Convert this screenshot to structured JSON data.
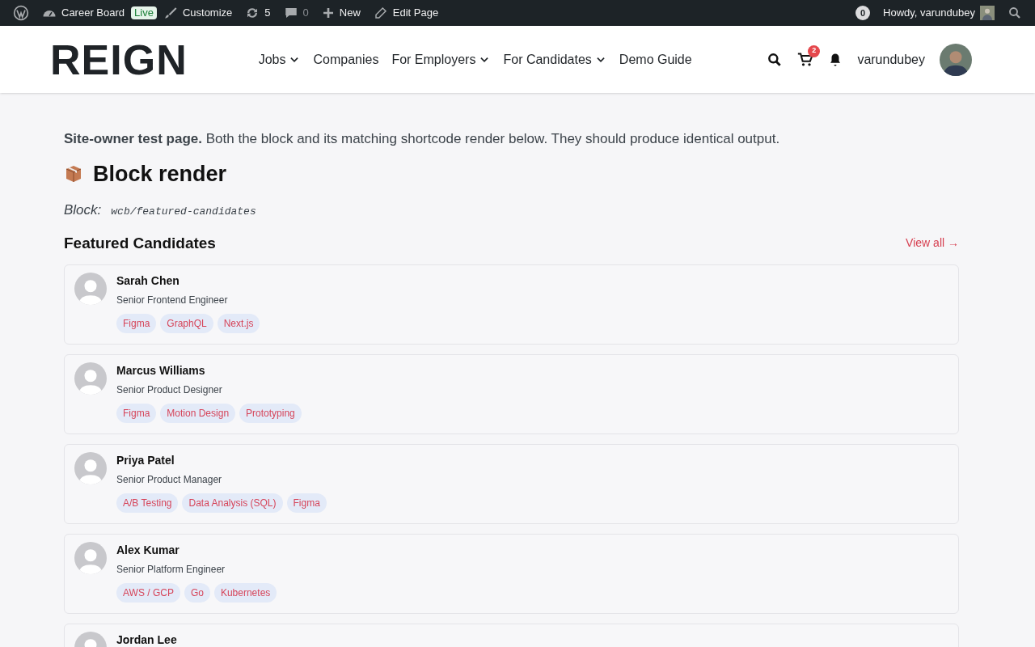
{
  "admin_bar": {
    "site": "Career Board",
    "live_badge": "Live",
    "customize": "Customize",
    "updates": "5",
    "comments": "0",
    "new": "New",
    "edit_page": "Edit Page",
    "notifications": "0",
    "howdy": "Howdy, varundubey"
  },
  "header": {
    "logo": "REIGN",
    "nav": [
      {
        "label": "Jobs",
        "has_dropdown": true
      },
      {
        "label": "Companies",
        "has_dropdown": false
      },
      {
        "label": "For Employers",
        "has_dropdown": true
      },
      {
        "label": "For Candidates",
        "has_dropdown": true
      },
      {
        "label": "Demo Guide",
        "has_dropdown": false
      }
    ],
    "cart_count": "2",
    "username": "varundubey"
  },
  "intro": "**Site-owner test page.** Both the block and its matching shortcode render below. They should produce identical output.",
  "heading": "Block render",
  "block_label": "Block:",
  "block_name": "wcb/featured-candidates",
  "section_title": "Featured Candidates",
  "view_all": "View all →",
  "candidates": [
    {
      "name": "Sarah Chen",
      "title": "Senior Frontend Engineer",
      "skills": [
        "Figma",
        "GraphQL",
        "Next.js"
      ]
    },
    {
      "name": "Marcus Williams",
      "title": "Senior Product Designer",
      "skills": [
        "Figma",
        "Motion Design",
        "Prototyping"
      ]
    },
    {
      "name": "Priya Patel",
      "title": "Senior Product Manager",
      "skills": [
        "A/B Testing",
        "Data Analysis (SQL)",
        "Figma"
      ]
    },
    {
      "name": "Alex Kumar",
      "title": "Senior Platform Engineer",
      "skills": [
        "AWS / GCP",
        "Go",
        "Kubernetes"
      ]
    },
    {
      "name": "Jordan Lee"
    }
  ]
}
